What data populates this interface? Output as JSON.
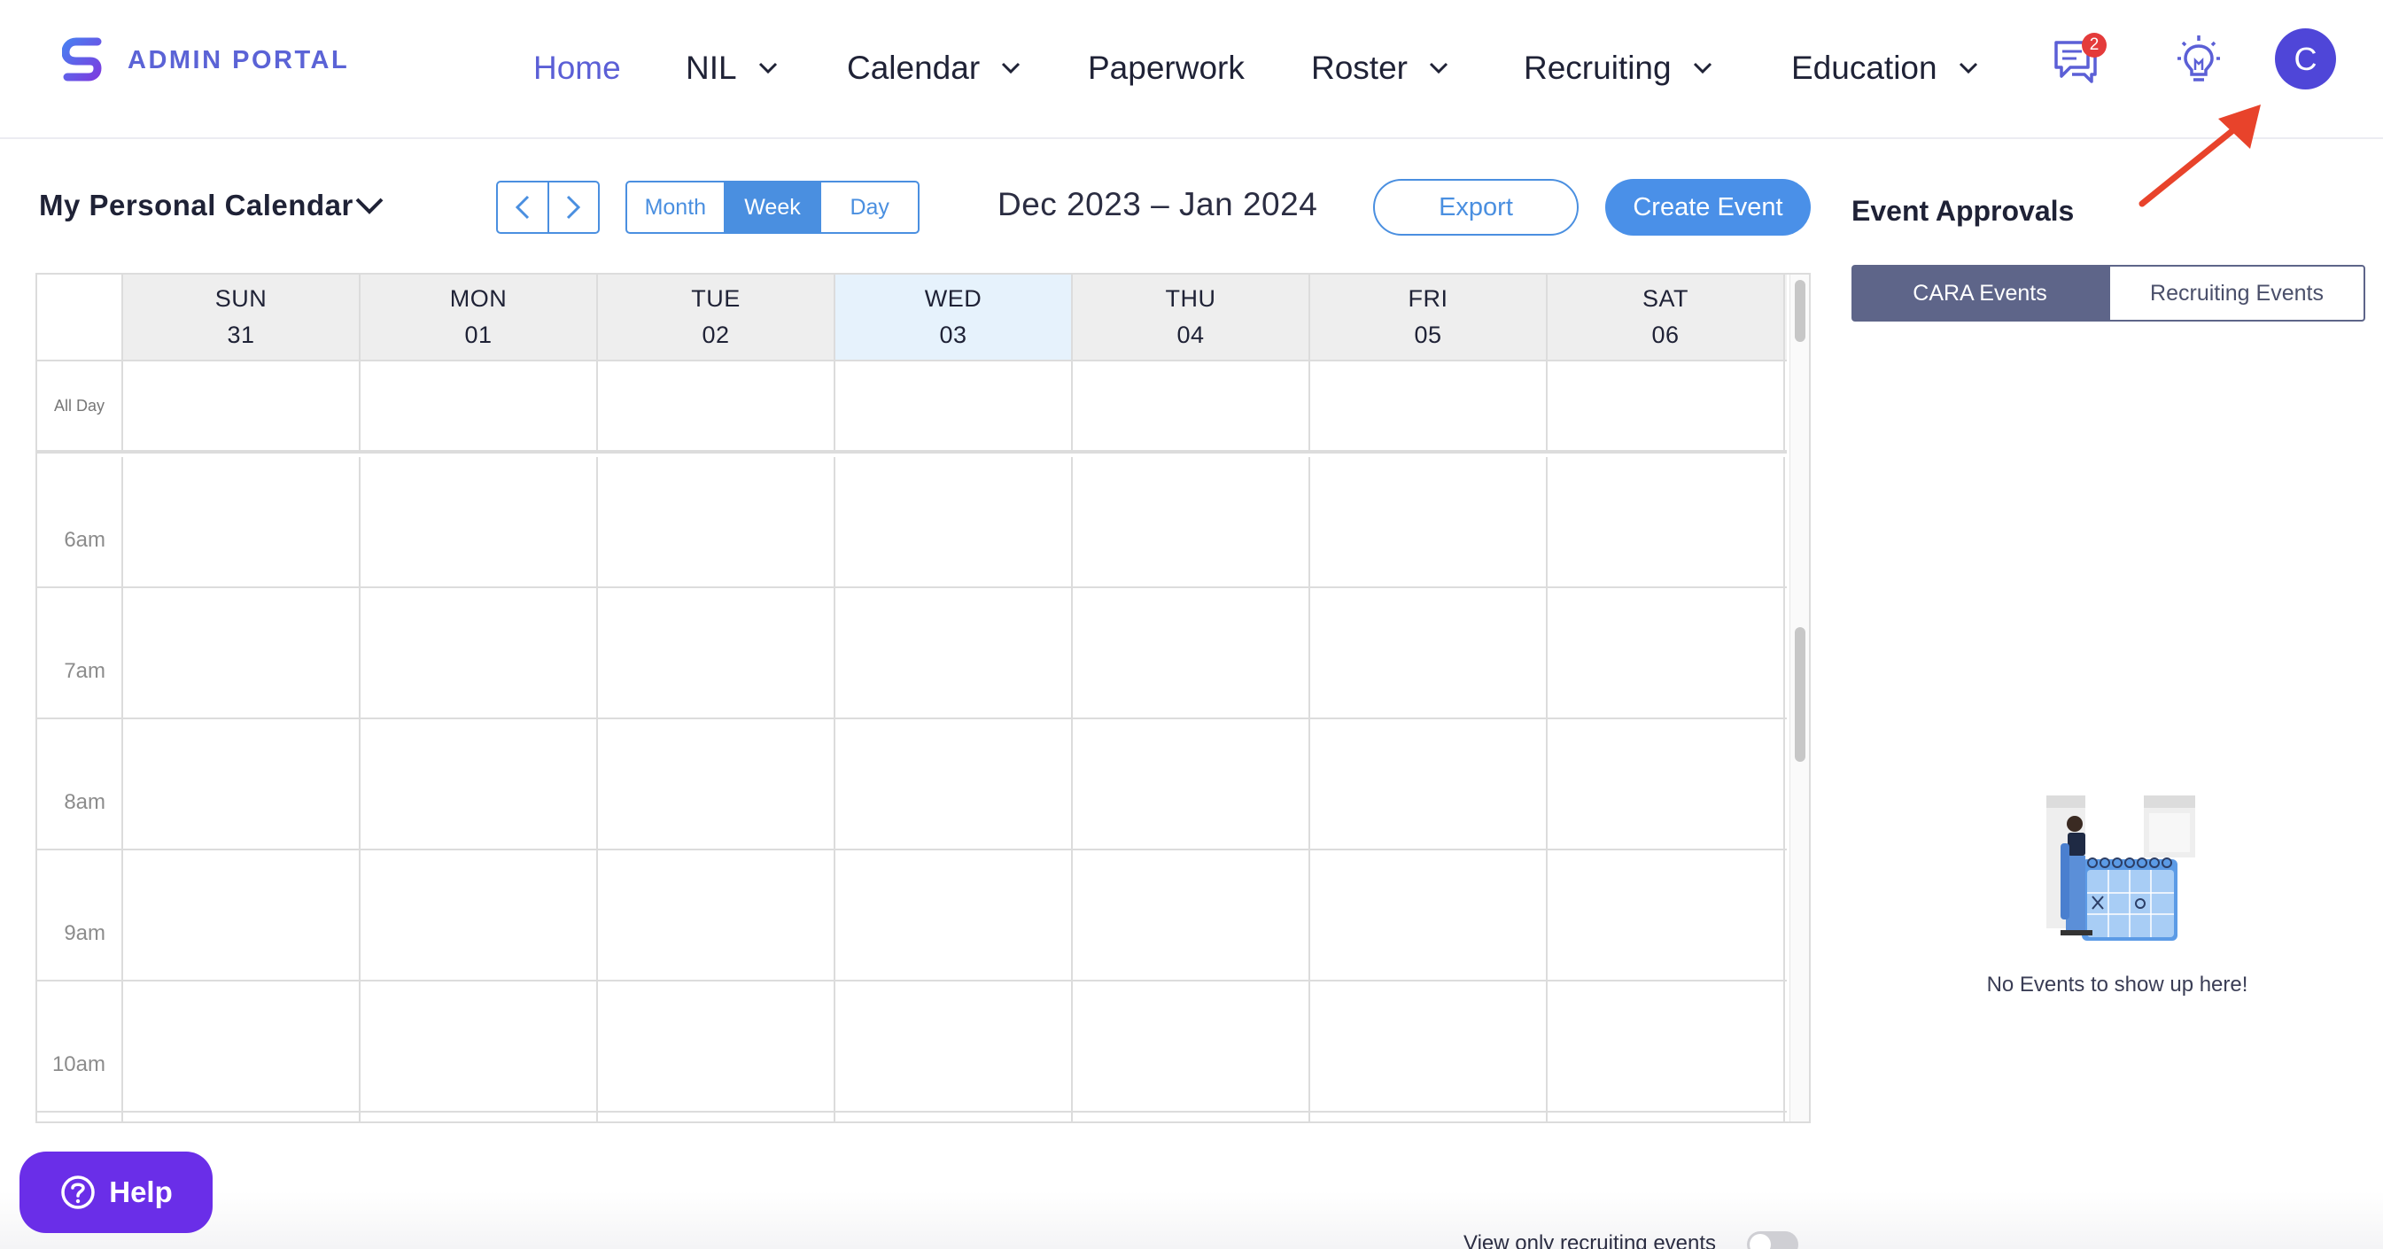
{
  "app": {
    "brand": "ADMIN PORTAL",
    "brand_color": "#5b63d6",
    "accent": "#4a8fe0"
  },
  "nav": {
    "items": [
      {
        "label": "Home",
        "active": true,
        "dropdown": false
      },
      {
        "label": "NIL",
        "active": false,
        "dropdown": true
      },
      {
        "label": "Calendar",
        "active": false,
        "dropdown": true
      },
      {
        "label": "Paperwork",
        "active": false,
        "dropdown": false
      },
      {
        "label": "Roster",
        "active": false,
        "dropdown": true
      },
      {
        "label": "Recruiting",
        "active": false,
        "dropdown": true
      },
      {
        "label": "Education",
        "active": false,
        "dropdown": true
      }
    ],
    "messages_icon": "chat-icon",
    "messages_badge": "2",
    "tips_icon": "lightbulb-icon",
    "avatar_initial": "C"
  },
  "toolbar": {
    "calendar_select": "My Personal Calendar",
    "prev_icon": "chevron-left-icon",
    "next_icon": "chevron-right-icon",
    "views": [
      "Month",
      "Week",
      "Day"
    ],
    "selected_view": "Week",
    "date_range": "Dec 2023 – Jan 2024",
    "export_label": "Export",
    "create_label": "Create Event"
  },
  "calendar": {
    "days": [
      {
        "name": "SUN",
        "date": "31"
      },
      {
        "name": "MON",
        "date": "01"
      },
      {
        "name": "TUE",
        "date": "02"
      },
      {
        "name": "WED",
        "date": "03",
        "today": true
      },
      {
        "name": "THU",
        "date": "04"
      },
      {
        "name": "FRI",
        "date": "05"
      },
      {
        "name": "SAT",
        "date": "06"
      }
    ],
    "all_day_label": "All Day",
    "hours": [
      "6am",
      "7am",
      "8am",
      "9am",
      "10am"
    ],
    "today_color": "#e6f2fc"
  },
  "approvals": {
    "title": "Event Approvals",
    "tabs": [
      "CARA Events",
      "Recruiting Events"
    ],
    "selected_tab": "CARA Events",
    "empty_text": "No Events to show up here!"
  },
  "footer": {
    "help_label": "Help",
    "toggle_label": "View only recruiting events",
    "toggle_on": false
  },
  "annotation": {
    "arrow_color": "#e8432b"
  }
}
